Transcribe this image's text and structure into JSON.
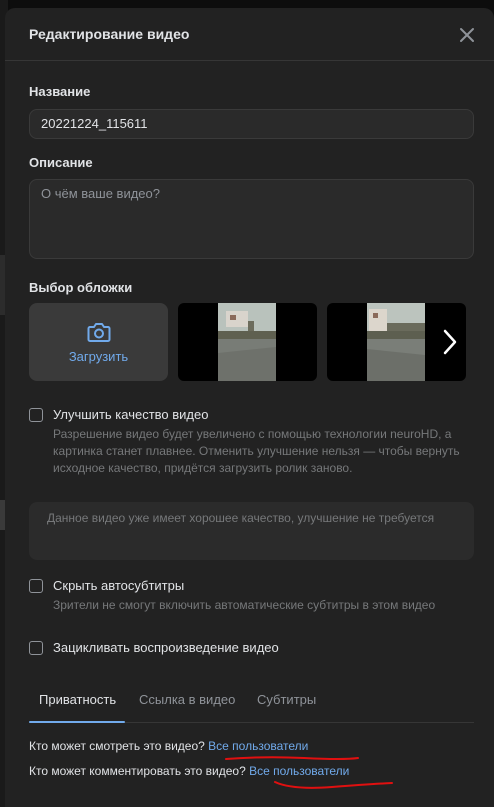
{
  "modal": {
    "title": "Редактирование видео"
  },
  "form": {
    "name_label": "Название",
    "name_value": "20221224_115611",
    "description_label": "Описание",
    "description_placeholder": "О чём ваше видео?",
    "cover_label": "Выбор обложки",
    "upload_label": "Загрузить"
  },
  "options": {
    "enhance_title": "Улучшить качество видео",
    "enhance_desc": "Разрешение видео будет увеличено с помощью технологии neuroHD, а картинка станет плавнее. Отменить улучшение нельзя — чтобы вернуть исходное качество, придётся загрузить ролик заново.",
    "enhance_info": "Данное видео уже имеет хорошее качество, улучшение не требуется",
    "subtitles_title": "Скрыть автосубтитры",
    "subtitles_desc": "Зрители не смогут включить автоматические субтитры в этом видео",
    "loop_title": "Зацикливать воспроизведение видео"
  },
  "tabs": [
    {
      "label": "Приватность",
      "active": true
    },
    {
      "label": "Ссылка в видео",
      "active": false
    },
    {
      "label": "Субтитры",
      "active": false
    }
  ],
  "privacy": {
    "view_question": "Кто может смотреть это видео?",
    "view_value": "Все пользователи",
    "comment_question": "Кто может комментировать это видео?",
    "comment_value": "Все пользователи"
  },
  "colors": {
    "accent": "#71aaeb",
    "annotation_red": "#e01010",
    "modal_bg": "#222222"
  }
}
